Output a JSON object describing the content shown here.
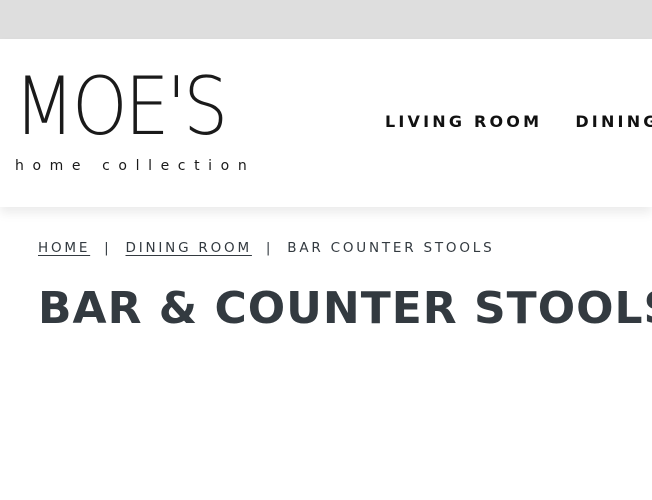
{
  "header": {
    "logo": {
      "brand": "MOE'S",
      "tagline": "home collection"
    },
    "nav": {
      "items": [
        {
          "label": "LIVING ROOM"
        },
        {
          "label": "DINING ROOM"
        }
      ]
    }
  },
  "breadcrumb": {
    "items": [
      {
        "label": "HOME"
      },
      {
        "label": "DINING ROOM"
      },
      {
        "label": "BAR COUNTER STOOLS"
      }
    ],
    "separator": "|"
  },
  "main": {
    "title": "BAR & COUNTER STOOLS"
  },
  "colors": {
    "top_strip": "#dedede",
    "text_dark": "#333a40",
    "logo": "#1a1a1a"
  }
}
